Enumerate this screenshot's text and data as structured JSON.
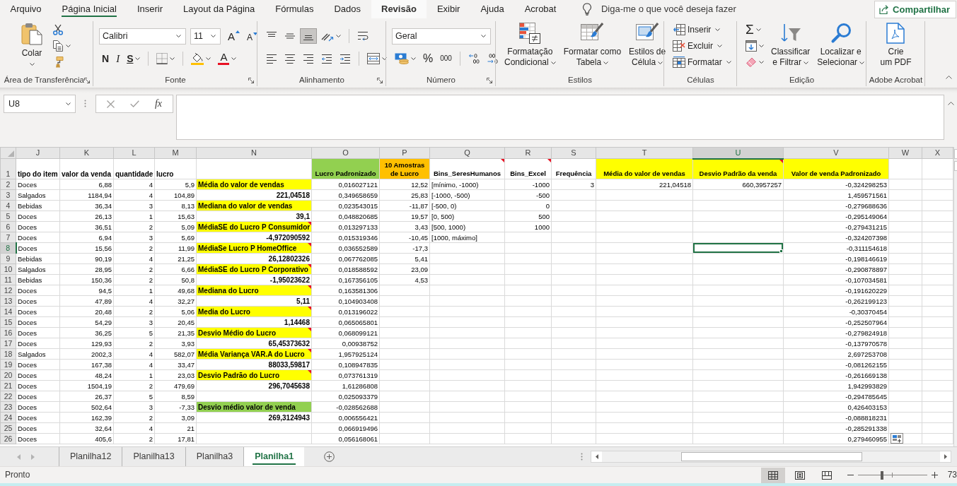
{
  "menu_tabs": [
    {
      "label": "Arquivo",
      "selected": false,
      "hovered": false
    },
    {
      "label": "Página Inicial",
      "selected": true,
      "hovered": false
    },
    {
      "label": "Inserir",
      "selected": false,
      "hovered": false
    },
    {
      "label": "Layout da Página",
      "selected": false,
      "hovered": false
    },
    {
      "label": "Fórmulas",
      "selected": false,
      "hovered": false
    },
    {
      "label": "Dados",
      "selected": false,
      "hovered": false
    },
    {
      "label": "Revisão",
      "selected": false,
      "hovered": true
    },
    {
      "label": "Exibir",
      "selected": false,
      "hovered": false
    },
    {
      "label": "Ajuda",
      "selected": false,
      "hovered": false
    },
    {
      "label": "Acrobat",
      "selected": false,
      "hovered": false
    }
  ],
  "tell_me": {
    "placeholder": "Diga-me o que você deseja fazer"
  },
  "share_button": {
    "label": "Compartilhar"
  },
  "ribbon": [
    {
      "title": "Área de Transferência",
      "launcher": true,
      "items": [
        {
          "kind": "large",
          "lines": [
            "Colar"
          ],
          "caret": true
        },
        {
          "kind": "stack",
          "rows": [
            {
              "controls": [
                {
                  "kind": "icon"
                }
              ]
            },
            {
              "controls": [
                {
                  "kind": "icon",
                  "caret": true
                }
              ]
            },
            {
              "controls": [
                {
                  "kind": "icon"
                }
              ]
            }
          ]
        }
      ]
    },
    {
      "title": "Fonte",
      "launcher": true,
      "items": [
        {
          "kind": "stack",
          "rows": [
            {
              "controls": [
                {
                  "kind": "combo",
                  "value": "Calibri"
                },
                {
                  "kind": "combo",
                  "value": "11"
                },
                {
                  "kind": "glyph_icon",
                  "label": "A"
                },
                {
                  "kind": "glyph_icon",
                  "label": "A"
                }
              ]
            },
            {
              "controls": [
                {
                  "kind": "toggle",
                  "label": "N",
                  "selected": false
                },
                {
                  "kind": "toggle",
                  "label": "I",
                  "selected": false
                },
                {
                  "kind": "toggle",
                  "label": "S",
                  "selected": false,
                  "caret": true
                },
                {
                  "kind": "separator"
                },
                {
                  "kind": "icon",
                  "caret": true
                },
                {
                  "kind": "separator"
                },
                {
                  "kind": "icon",
                  "caret": true
                },
                {
                  "kind": "glyph_icon",
                  "label": "A",
                  "caret": true
                }
              ]
            }
          ]
        }
      ]
    },
    {
      "title": "Alinhamento",
      "launcher": true,
      "items": [
        {
          "kind": "stack",
          "rows": [
            {
              "controls": [
                {
                  "kind": "toggle_icon",
                  "selected": false
                },
                {
                  "kind": "toggle_icon",
                  "selected": false
                },
                {
                  "kind": "toggle_icon",
                  "selected": true
                },
                {
                  "kind": "icon",
                  "caret": true
                },
                {
                  "kind": "separator"
                },
                {
                  "kind": "icon"
                }
              ]
            },
            {
              "controls": [
                {
                  "kind": "toggle_icon",
                  "selected": false
                },
                {
                  "kind": "toggle_icon",
                  "selected": false
                },
                {
                  "kind": "toggle_icon",
                  "selected": false
                },
                {
                  "kind": "icon"
                },
                {
                  "kind": "icon"
                },
                {
                  "kind": "separator"
                },
                {
                  "kind": "icon",
                  "caret": true
                }
              ]
            }
          ]
        }
      ]
    },
    {
      "title": "Número",
      "launcher": true,
      "items": [
        {
          "kind": "stack",
          "rows": [
            {
              "controls": [
                {
                  "kind": "combo",
                  "value": "Geral"
                }
              ]
            },
            {
              "controls": [
                {
                  "kind": "icon",
                  "caret": true
                },
                {
                  "kind": "glyph",
                  "label": "%"
                },
                {
                  "kind": "glyph",
                  "label": "000"
                },
                {
                  "kind": "separator"
                },
                {
                  "kind": "icon"
                },
                {
                  "kind": "icon"
                }
              ]
            }
          ]
        }
      ]
    },
    {
      "title": "Estilos",
      "launcher": false,
      "items": [
        {
          "kind": "large",
          "lines": [
            "Formatação",
            "Condicional"
          ],
          "caret": true
        },
        {
          "kind": "large",
          "lines": [
            "Formatar como",
            "Tabela"
          ],
          "caret": true
        },
        {
          "kind": "large",
          "lines": [
            "Estilos de",
            "Célula"
          ],
          "caret": true
        }
      ]
    },
    {
      "title": "Células",
      "launcher": false,
      "items": [
        {
          "kind": "stack",
          "rows": [
            {
              "controls": [
                {
                  "kind": "small",
                  "label": "Inserir",
                  "caret": true
                }
              ]
            },
            {
              "controls": [
                {
                  "kind": "small",
                  "label": "Excluir",
                  "caret": true
                }
              ]
            },
            {
              "controls": [
                {
                  "kind": "small",
                  "label": "Formatar",
                  "caret": true
                }
              ]
            }
          ]
        }
      ]
    },
    {
      "title": "Edição",
      "launcher": false,
      "items": [
        {
          "kind": "stack",
          "rows": [
            {
              "controls": [
                {
                  "kind": "glyph",
                  "label": "Σ",
                  "caret": true
                }
              ]
            },
            {
              "controls": [
                {
                  "kind": "icon",
                  "caret": true
                }
              ]
            },
            {
              "controls": [
                {
                  "kind": "icon",
                  "caret": true
                }
              ]
            }
          ]
        },
        {
          "kind": "large",
          "lines": [
            "Classificar",
            "e Filtrar"
          ],
          "caret": true
        },
        {
          "kind": "large",
          "lines": [
            "Localizar e",
            "Selecionar"
          ],
          "caret": true
        }
      ]
    },
    {
      "title": "Adobe Acrobat",
      "launcher": false,
      "items": [
        {
          "kind": "large",
          "lines": [
            "Crie",
            "um PDF"
          ]
        }
      ]
    }
  ],
  "formula_bar": {
    "name_box": "U8",
    "function_label": "fx"
  },
  "sheet": {
    "columns": [
      {
        "letter": "J",
        "kind": "text",
        "selected": false
      },
      {
        "letter": "K",
        "kind": "number",
        "selected": false
      },
      {
        "letter": "L",
        "kind": "number",
        "selected": false
      },
      {
        "letter": "M",
        "kind": "number",
        "selected": false
      },
      {
        "letter": "N",
        "selected": false
      },
      {
        "letter": "O",
        "kind": "number",
        "selected": false
      },
      {
        "letter": "P",
        "kind": "number",
        "selected": false
      },
      {
        "letter": "Q",
        "kind": "text",
        "selected": false
      },
      {
        "letter": "R",
        "kind": "number",
        "selected": false
      },
      {
        "letter": "S",
        "kind": "number",
        "selected": false
      },
      {
        "letter": "T",
        "kind": "number",
        "selected": false
      },
      {
        "letter": "U",
        "kind": "number",
        "selected": true
      },
      {
        "letter": "V",
        "kind": "number",
        "selected": false
      },
      {
        "letter": "W",
        "selected": false
      },
      {
        "letter": "X",
        "selected": false
      }
    ],
    "rows": [
      {
        "number": "1",
        "selected": false,
        "cells": [
          {
            "text": "tipo do item",
            "kind": "label",
            "note": false
          },
          {
            "text": "valor da venda",
            "kind": "label",
            "note": false
          },
          {
            "text": "quantidade",
            "kind": "label",
            "note": false
          },
          {
            "text": "lucro",
            "kind": "label",
            "note": false
          },
          null,
          {
            "text": "Lucro Padronizado",
            "kind": "heading",
            "color": "#92d050",
            "note": false
          },
          {
            "text": "10 Amostras de Lucro",
            "kind": "heading",
            "color": "#ffc000",
            "note": false
          },
          {
            "text": "Bins_SeresHumanos",
            "kind": "heading",
            "note": true
          },
          {
            "text": "Bins_Excel",
            "kind": "heading",
            "note": true
          },
          {
            "text": "Frequência",
            "kind": "heading",
            "note": false
          },
          {
            "text": "Média do valor de vendas",
            "kind": "heading",
            "color": "#ffff00",
            "note": false
          },
          {
            "text": "Desvio Padrão da venda",
            "kind": "heading",
            "color": "#ffff00",
            "note": true
          },
          {
            "text": "Valor de venda Padronizado",
            "kind": "heading",
            "color": "#ffff00",
            "note": false
          }
        ]
      },
      {
        "number": "2",
        "selected": false,
        "cells": [
          "Doces",
          "6,88",
          "4",
          "5,9",
          {
            "text": "Média do valor de vendas",
            "kind": "label",
            "color": "#ffff00",
            "note": false
          },
          "0,016027121",
          "12,52",
          "[mínimo, -1000)",
          "-1000",
          "3",
          "221,04518",
          "660,3957257",
          "-0,324298253"
        ]
      },
      {
        "number": "3",
        "selected": false,
        "cells": [
          "Salgados",
          "1184,94",
          "4",
          "104,89",
          {
            "text": "221,04518",
            "kind": "result",
            "note": false
          },
          "0,349658659",
          "25,83",
          "[-1000, -500)",
          "-500",
          null,
          null,
          null,
          "1,459571561"
        ]
      },
      {
        "number": "4",
        "selected": false,
        "cells": [
          "Bebidas",
          "36,34",
          "3",
          "8,13",
          {
            "text": "Mediana do valor de vendas",
            "kind": "label",
            "color": "#ffff00",
            "note": false
          },
          "0,023543015",
          "-11,87",
          "[-500, 0)",
          "0",
          null,
          null,
          null,
          "-0,279688636"
        ]
      },
      {
        "number": "5",
        "selected": false,
        "cells": [
          "Doces",
          "26,13",
          "1",
          "15,63",
          {
            "text": "39,1",
            "kind": "result",
            "note": false
          },
          "0,048820685",
          "19,57",
          "[0, 500)",
          "500",
          null,
          null,
          null,
          "-0,295149064"
        ]
      },
      {
        "number": "6",
        "selected": false,
        "cells": [
          "Doces",
          "36,51",
          "2",
          "5,09",
          {
            "text": "MédiaSE do Lucro P Consumidor",
            "kind": "label",
            "color": "#ffff00",
            "note": true
          },
          "0,013297133",
          "3,43",
          "[500, 1000)",
          "1000",
          null,
          null,
          null,
          "-0,279431215"
        ]
      },
      {
        "number": "7",
        "selected": false,
        "cells": [
          "Doces",
          "6,94",
          "3",
          "5,69",
          {
            "text": "-4,972090592",
            "kind": "result",
            "note": false
          },
          "0,015319346",
          "-10,45",
          "[1000, máximo]",
          null,
          null,
          null,
          null,
          "-0,324207398"
        ]
      },
      {
        "number": "8",
        "selected": true,
        "cells": [
          "Doces",
          "15,56",
          "2",
          "11,99",
          {
            "text": "MédiaSe Lucro P HomeOffice",
            "kind": "label",
            "color": "#ffff00",
            "note": true
          },
          "0,036552589",
          "-17,3",
          null,
          null,
          null,
          null,
          null,
          "-0,311154618"
        ]
      },
      {
        "number": "9",
        "selected": false,
        "cells": [
          "Bebidas",
          "90,19",
          "4",
          "21,25",
          {
            "text": "26,12802326",
            "kind": "result",
            "note": false
          },
          "0,067762085",
          "5,41",
          null,
          null,
          null,
          null,
          null,
          "-0,198146619"
        ]
      },
      {
        "number": "10",
        "selected": false,
        "cells": [
          "Salgados",
          "28,95",
          "2",
          "6,66",
          {
            "text": "MédiaSE do Lucro P Corporativo",
            "kind": "label",
            "color": "#ffff00",
            "note": true
          },
          "0,018588592",
          "23,09",
          null,
          null,
          null,
          null,
          null,
          "-0,290878897"
        ]
      },
      {
        "number": "11",
        "selected": false,
        "cells": [
          "Bebidas",
          "150,36",
          "2",
          "50,8",
          {
            "text": "-1,95023622",
            "kind": "result",
            "note": false
          },
          "0,167356105",
          "4,53",
          null,
          null,
          null,
          null,
          null,
          "-0,107034581"
        ]
      },
      {
        "number": "12",
        "selected": false,
        "cells": [
          "Doces",
          "94,5",
          "1",
          "49,68",
          {
            "text": "Mediana do Lucro",
            "kind": "label",
            "color": "#ffff00",
            "note": true
          },
          "0,163581306",
          null,
          null,
          null,
          null,
          null,
          null,
          "-0,191620229"
        ]
      },
      {
        "number": "13",
        "selected": false,
        "cells": [
          "Doces",
          "47,89",
          "4",
          "32,27",
          {
            "text": "5,11",
            "kind": "result",
            "note": false
          },
          "0,104903408",
          null,
          null,
          null,
          null,
          null,
          null,
          "-0,262199123"
        ]
      },
      {
        "number": "14",
        "selected": false,
        "cells": [
          "Doces",
          "20,48",
          "2",
          "5,06",
          {
            "text": "Media do Lucro",
            "kind": "label",
            "color": "#ffff00",
            "note": true
          },
          "0,013196022",
          null,
          null,
          null,
          null,
          null,
          null,
          "-0,30370454"
        ]
      },
      {
        "number": "15",
        "selected": false,
        "cells": [
          "Doces",
          "54,29",
          "3",
          "20,45",
          {
            "text": "1,14468",
            "kind": "result",
            "note": false
          },
          "0,065065801",
          null,
          null,
          null,
          null,
          null,
          null,
          "-0,252507964"
        ]
      },
      {
        "number": "16",
        "selected": false,
        "cells": [
          "Doces",
          "36,25",
          "5",
          "21,35",
          {
            "text": "Desvio Médio do Lucro",
            "kind": "label",
            "color": "#ffff00",
            "note": true
          },
          "0,068099121",
          null,
          null,
          null,
          null,
          null,
          null,
          "-0,279824918"
        ]
      },
      {
        "number": "17",
        "selected": false,
        "cells": [
          "Doces",
          "129,93",
          "2",
          "3,93",
          {
            "text": "65,45373632",
            "kind": "result",
            "note": false
          },
          "0,00938752",
          null,
          null,
          null,
          null,
          null,
          null,
          "-0,137970578"
        ]
      },
      {
        "number": "18",
        "selected": false,
        "cells": [
          "Salgados",
          "2002,3",
          "4",
          "582,07",
          {
            "text": "Média Variança VAR.A do Lucro",
            "kind": "label",
            "color": "#ffff00",
            "note": true
          },
          "1,957925124",
          null,
          null,
          null,
          null,
          null,
          null,
          "2,697253708"
        ]
      },
      {
        "number": "19",
        "selected": false,
        "cells": [
          "Doces",
          "167,38",
          "4",
          "33,47",
          {
            "text": "88033,59817",
            "kind": "result",
            "note": false
          },
          "0,108947835",
          null,
          null,
          null,
          null,
          null,
          null,
          "-0,081262155"
        ]
      },
      {
        "number": "20",
        "selected": false,
        "cells": [
          "Doces",
          "48,24",
          "1",
          "23,03",
          {
            "text": "Desvio Padrão do Lucro",
            "kind": "label",
            "color": "#ffff00",
            "note": true
          },
          "0,073761319",
          null,
          null,
          null,
          null,
          null,
          null,
          "-0,261669138"
        ]
      },
      {
        "number": "21",
        "selected": false,
        "cells": [
          "Doces",
          "1504,19",
          "2",
          "479,69",
          {
            "text": "296,7045638",
            "kind": "result",
            "note": false
          },
          "1,61286808",
          null,
          null,
          null,
          null,
          null,
          null,
          "1,942993829"
        ]
      },
      {
        "number": "22",
        "selected": false,
        "cells": [
          "Doces",
          "26,37",
          "5",
          "8,59",
          null,
          "0,025093379",
          null,
          null,
          null,
          null,
          null,
          null,
          "-0,294785645"
        ]
      },
      {
        "number": "23",
        "selected": false,
        "cells": [
          "Doces",
          "502,64",
          "3",
          "-7,33",
          {
            "text": "Desvio médio valor de venda",
            "kind": "label",
            "color": "#92d050",
            "note": false
          },
          "-0,028562688",
          null,
          null,
          null,
          null,
          null,
          null,
          "0,426403153"
        ]
      },
      {
        "number": "24",
        "selected": false,
        "cells": [
          "Doces",
          "162,39",
          "2",
          "3,09",
          {
            "text": "269,3124943",
            "kind": "result",
            "note": false
          },
          "0,006556421",
          null,
          null,
          null,
          null,
          null,
          null,
          "-0,088818231"
        ]
      },
      {
        "number": "25",
        "selected": false,
        "cells": [
          "Doces",
          "32,64",
          "4",
          "21",
          null,
          "0,066919496",
          null,
          null,
          null,
          null,
          null,
          null,
          "-0,285291338"
        ]
      },
      {
        "number": "26",
        "selected": false,
        "cells": [
          "Doces",
          "405,6",
          "2",
          "17,81",
          null,
          "0,056168061",
          null,
          null,
          null,
          null,
          null,
          null,
          "0,279460955"
        ]
      }
    ]
  },
  "sheet_tabs": [
    {
      "label": "Planilha12",
      "selected": false
    },
    {
      "label": "Planilha13",
      "selected": false
    },
    {
      "label": "Planilha3",
      "selected": false
    },
    {
      "label": "Planilha1",
      "selected": true
    }
  ],
  "status_bar": {
    "text": "Pronto",
    "views": [
      {
        "selected": true
      },
      {
        "selected": false
      },
      {
        "selected": false
      }
    ],
    "zoom": {
      "level": 0.35,
      "reading": "73"
    }
  }
}
